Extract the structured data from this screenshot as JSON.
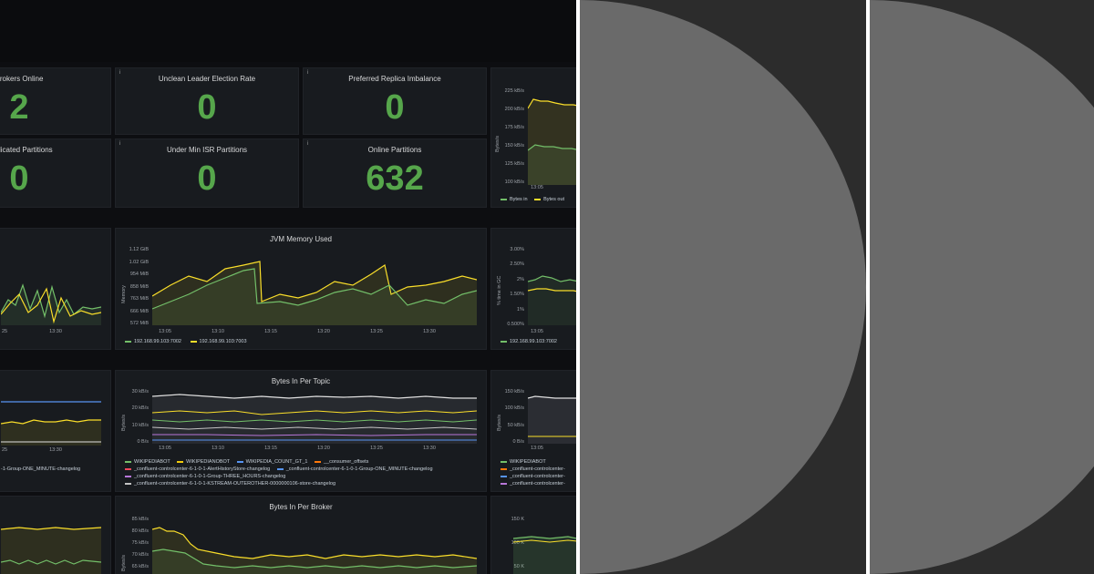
{
  "stats": {
    "brokers_online": {
      "title": "Brokers Online",
      "value": "2"
    },
    "unclean_leader": {
      "title": "Unclean Leader Election Rate",
      "value": "0"
    },
    "preferred_replica": {
      "title": "Preferred Replica Imbalance",
      "value": "0"
    },
    "replicated_partitions": {
      "title": "Replicated Partitions",
      "value": "0"
    },
    "under_min_isr": {
      "title": "Under Min ISR Partitions",
      "value": "0"
    },
    "online_partitions": {
      "title": "Online Partitions",
      "value": "632"
    }
  },
  "info_glyph": "i",
  "throughput": {
    "ylabels": [
      "225 kB/s",
      "200 kB/s",
      "175 kB/s",
      "150 kB/s",
      "125 kB/s",
      "100 kB/s"
    ],
    "yaxis": "Bytes/s",
    "xlabels": [
      "13:05"
    ],
    "legend": [
      "Bytes in",
      "Bytes out"
    ]
  },
  "left_mid": {
    "xlabels": [
      "25",
      "13:30"
    ]
  },
  "jvm": {
    "title": "JVM Memory Used",
    "ylabels": [
      "1.12 GiB",
      "1.02 GiB",
      "954 MiB",
      "858 MiB",
      "763 MiB",
      "666 MiB",
      "572 MiB"
    ],
    "yaxis": "Memory",
    "xlabels": [
      "13:05",
      "13:10",
      "13:15",
      "13:20",
      "13:25",
      "13:30"
    ],
    "legend": [
      "192.168.99.103:7002",
      "192.168.99.103:7003"
    ]
  },
  "gc": {
    "ylabels": [
      "3.00%",
      "2.50%",
      "2%",
      "1.50%",
      "1%",
      "0.500%"
    ],
    "yaxis": "% time in GC",
    "xlabels": [
      "13:05"
    ],
    "legend": [
      "192.168.99.103:7002"
    ]
  },
  "left_low": {
    "xlabels": [
      "25",
      "13:30"
    ],
    "legend_tail": "-1-Group-ONE_MINUTE-changelog"
  },
  "bytes_topic": {
    "title": "Bytes In Per Topic",
    "ylabels": [
      "30 kB/s",
      "20 kB/s",
      "10 kB/s",
      "0 B/s"
    ],
    "yaxis": "Bytes/s",
    "xlabels": [
      "13:05",
      "13:10",
      "13:15",
      "13:20",
      "13:25",
      "13:30"
    ],
    "legend": [
      "WIKIPEDIABOT",
      "WIKIPEDIANOBOT",
      "WIKIPEDIA_COUNT_GT_1",
      "__consumer_offsets",
      "_confluent-controlcenter-6-1-0-1-AlertHistoryStore-changelog",
      "_confluent-controlcenter-6-1-0-1-Group-ONE_MINUTE-changelog",
      "_confluent-controlcenter-6-1-0-1-Group-THREE_HOURS-changelog",
      "_confluent-controlcenter-6-1-0-1-KSTREAM-OUTEROTHER-0000000106-store-changelog"
    ],
    "colors": [
      "#73bf69",
      "#f2cc0c",
      "#5794f2",
      "#ff780a",
      "#f2495c",
      "#5794f2",
      "#b877d9",
      "#c4c4c4"
    ]
  },
  "bytes_topic_right": {
    "ylabels": [
      "150 kB/s",
      "100 kB/s",
      "50 kB/s",
      "0 B/s"
    ],
    "yaxis": "Bytes/s",
    "xlabels": [
      "13:05"
    ],
    "legend": [
      "WIKIPEDIABOT",
      "_confluent-controlcenter-",
      "_confluent-controlcenter-",
      "_confluent-controlcenter-"
    ]
  },
  "bytes_broker": {
    "title": "Bytes In Per Broker",
    "ylabels": [
      "85 kB/s",
      "80 kB/s",
      "75 kB/s",
      "70 kB/s",
      "65 kB/s"
    ],
    "yaxis": "Bytes/s"
  },
  "bottom_right": {
    "ylabels": [
      "150 K",
      "100 K",
      "50 K"
    ]
  },
  "colors": {
    "green": "#73bf69",
    "yellow": "#fade2a",
    "stat_green": "#56a64b",
    "blue": "#5794f2",
    "panel": "#181b1f"
  }
}
